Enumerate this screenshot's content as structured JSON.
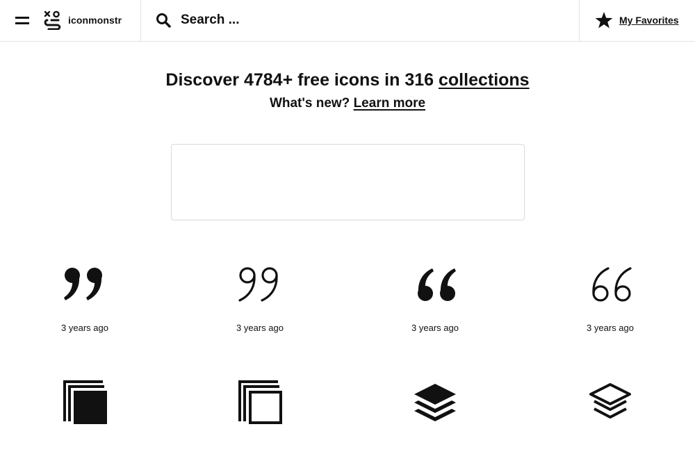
{
  "header": {
    "brand": "iconmonstr",
    "search_placeholder": "Search ...",
    "favorites_label": "My Favorites"
  },
  "hero": {
    "headline_prefix": "Discover 4784+ free icons in 316 ",
    "headline_link": "collections",
    "subline_prefix": "What's new? ",
    "subline_link": "Learn more"
  },
  "icons": [
    {
      "name": "quote-bold-right",
      "date": "3 years ago"
    },
    {
      "name": "quote-thin-right",
      "date": "3 years ago"
    },
    {
      "name": "quote-bold-left",
      "date": "3 years ago"
    },
    {
      "name": "quote-thin-left",
      "date": "3 years ago"
    },
    {
      "name": "stacked-squares-filled",
      "date": ""
    },
    {
      "name": "stacked-squares-outline",
      "date": ""
    },
    {
      "name": "layers-filled",
      "date": ""
    },
    {
      "name": "layers-outline",
      "date": ""
    }
  ],
  "colors": {
    "text": "#111111",
    "border": "#e2e2e2",
    "background": "#ffffff"
  }
}
